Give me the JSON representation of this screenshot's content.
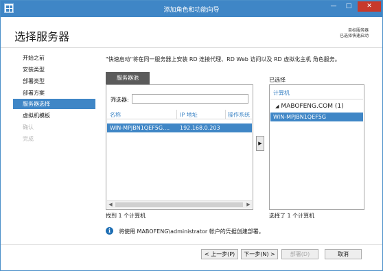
{
  "window": {
    "title": "添加角色和功能向导",
    "minimize_glyph": "—",
    "maximize_glyph": "□",
    "close_glyph": "✕"
  },
  "header": {
    "page_title": "选择服务器",
    "target_server_label": "目标服务器",
    "target_server_value": "已选择快速启动"
  },
  "nav": {
    "items": [
      {
        "label": "开始之前",
        "state": "normal"
      },
      {
        "label": "安装类型",
        "state": "normal"
      },
      {
        "label": "部署类型",
        "state": "normal"
      },
      {
        "label": "部署方案",
        "state": "normal"
      },
      {
        "label": "服务器选择",
        "state": "active"
      },
      {
        "label": "虚拟机模板",
        "state": "normal"
      },
      {
        "label": "确认",
        "state": "disabled"
      },
      {
        "label": "完成",
        "state": "disabled"
      }
    ]
  },
  "main": {
    "description": "\"快速启动\"将在同一服务器上安装 RD 连接代理、RD Web 访问以及 RD 虚拟化主机 角色服务。",
    "pool_tab": "服务器池",
    "filter_label": "筛选器:",
    "filter_value": "",
    "columns": [
      "名称",
      "IP 地址",
      "操作系统"
    ],
    "rows": [
      {
        "name": "WIN-MPJBN1QEF5G....",
        "ip": "192.168.0.203",
        "os": ""
      }
    ],
    "found_text": "找到 1 个计算机",
    "add_button_glyph": "▶",
    "scroll_left_glyph": "◀",
    "scroll_right_glyph": "▶"
  },
  "selected": {
    "title": "已选择",
    "column": "计算机",
    "group_label": "MABOFENG.COM (1)",
    "group_arrow": "◢",
    "items": [
      "WIN-MPJBN1QEF5G"
    ],
    "count_text": "选择了 1 个计算机"
  },
  "info": {
    "icon_glyph": "i",
    "text": "将使用 MABOFENG\\administrator 帐户的凭据创建部署。"
  },
  "buttons": {
    "prev": "< 上一步(P)",
    "next": "下一步(N) >",
    "deploy": "部署(D)",
    "cancel": "取消"
  },
  "colors": {
    "accent": "#3f86c6",
    "close": "#c7392b",
    "tab": "#5b5b5b"
  }
}
